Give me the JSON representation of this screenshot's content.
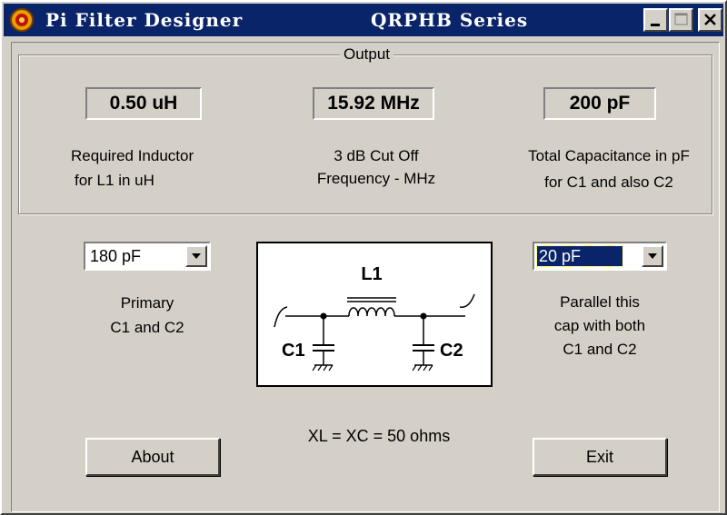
{
  "window": {
    "title": "Pi Filter Designer",
    "series": "QRPHB Series",
    "controls": {
      "minimize": "minimize-icon",
      "maximize": "maximize-icon",
      "close": "close-icon"
    }
  },
  "output": {
    "group_label": "Output",
    "inductor_value": "0.50 uH",
    "frequency_value": "15.92 MHz",
    "capacitance_value": "200 pF",
    "inductor_caption_1": "Required  Inductor",
    "inductor_caption_2": "for  L1 in uH",
    "frequency_caption_1": "3 dB Cut Off",
    "frequency_caption_2": "Frequency - MHz",
    "capacitance_caption_1": "Total Capacitance in pF",
    "capacitance_caption_2": "for C1 and also C2"
  },
  "primary": {
    "selected": "180 pF",
    "caption_1": "Primary",
    "caption_2": "C1 and C2"
  },
  "parallel": {
    "selected": "20 pF",
    "caption_1": "Parallel this",
    "caption_2": "cap with both",
    "caption_3": "C1 and C2"
  },
  "schematic": {
    "l1_label": "L1",
    "c1_label": "C1",
    "c2_label": "C2"
  },
  "formula": "XL = XC = 50 ohms",
  "buttons": {
    "about": "About",
    "exit": "Exit"
  },
  "colors": {
    "titlebar": "#0a246a",
    "face": "#d4d0c8",
    "selection": "#0a246a"
  }
}
